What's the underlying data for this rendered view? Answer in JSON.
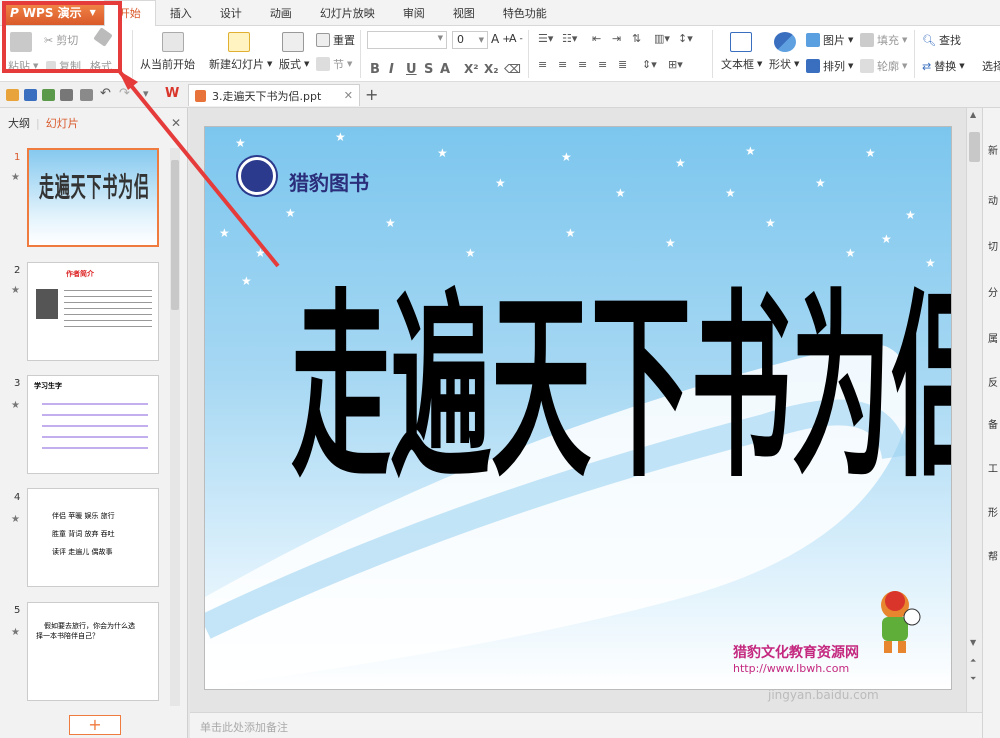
{
  "app": {
    "name": "WPS 演示"
  },
  "menu": {
    "tabs": [
      "开始",
      "插入",
      "设计",
      "动画",
      "幻灯片放映",
      "审阅",
      "视图",
      "特色功能"
    ]
  },
  "ribbon": {
    "cut": "剪切",
    "paste": "粘贴",
    "copy": "复制",
    "format_painter": "格式",
    "from_current": "从当前开始",
    "new_slide": "新建幻灯片",
    "layout": "版式",
    "section": "节",
    "reset": "重置",
    "font_size": "0",
    "text_box": "文本框",
    "shapes": "形状",
    "picture": "图片",
    "fill": "填充",
    "arrange": "排列",
    "outline": "轮廓",
    "find": "查找",
    "replace": "替换",
    "select": "选择"
  },
  "document": {
    "tab_title": "3.走遍天下书为侣.ppt"
  },
  "left_pane": {
    "tab_outline": "大纲",
    "tab_slides": "幻灯片",
    "slide_numbers": [
      "1",
      "2",
      "3",
      "4",
      "5"
    ]
  },
  "slide": {
    "brand": "猎豹图书",
    "title_chars": [
      "走",
      "遍",
      "天",
      "下",
      "书",
      "为",
      "侣"
    ],
    "footer_site": "猎豹文化教育资源网",
    "footer_url": "http://www.lbwh.com"
  },
  "thumb2": {
    "heading": "作者简介"
  },
  "thumb3": {
    "heading": "学习生字"
  },
  "thumb4": {
    "rows": [
      "伴侣  苹暖  娱乐  旅行",
      "胜童  背词  放弃  吞吐",
      "读评  走遍儿  偶故事"
    ]
  },
  "thumb5": {
    "line1": "假如要去旅行，你会为什么选",
    "line2": "择一本书陪伴自己？"
  },
  "sidebar": {
    "items": [
      "新",
      "动",
      "切",
      "分",
      "属",
      "反",
      "备",
      "工",
      "形",
      "帮"
    ]
  },
  "status": {
    "notes_placeholder": "单击此处添加备注"
  },
  "watermark": "jingyan.baidu.com"
}
